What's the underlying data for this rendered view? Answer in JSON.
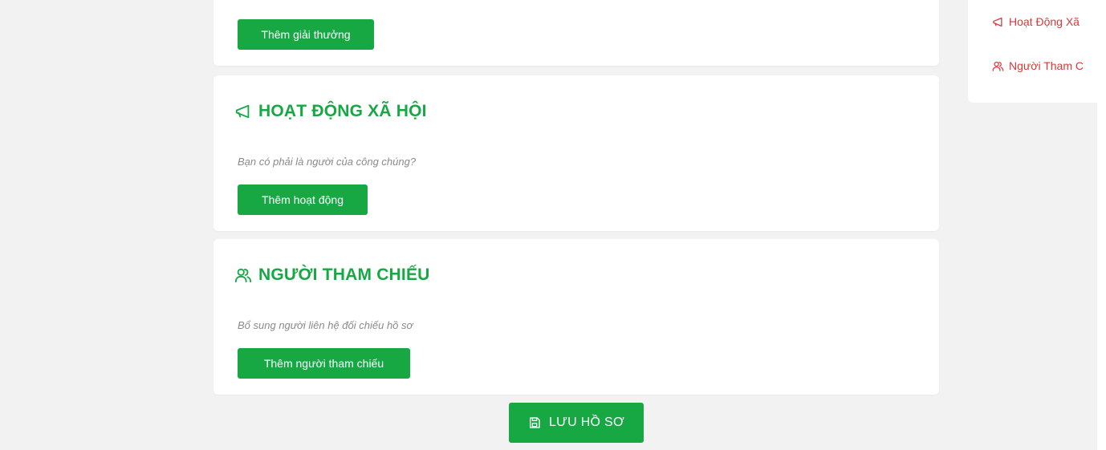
{
  "awards_section": {
    "add_button": "Thêm giải thưởng"
  },
  "social_section": {
    "title": "HOẠT ĐỘNG XÃ HỘI",
    "icon": "megaphone-icon",
    "description": "Bạn có phải là người của công chúng?",
    "add_button": "Thêm hoạt động"
  },
  "reference_section": {
    "title": "NGƯỜI THAM CHIẾU",
    "icon": "users-icon",
    "description": "Bổ sung người liên hệ đối chiếu hồ sơ",
    "add_button": "Thêm người tham chiếu"
  },
  "save": {
    "label": "LƯU HỒ SƠ",
    "icon": "save-icon"
  },
  "side_nav": {
    "items": [
      {
        "label": "Hoạt Động Xã",
        "icon": "megaphone-icon"
      },
      {
        "label": "Người Tham C",
        "icon": "users-icon"
      }
    ]
  },
  "colors": {
    "brand_green": "#17a844",
    "nav_red": "#d43a3a",
    "background": "#f2f2f2",
    "muted_text": "#8a8a8a"
  }
}
